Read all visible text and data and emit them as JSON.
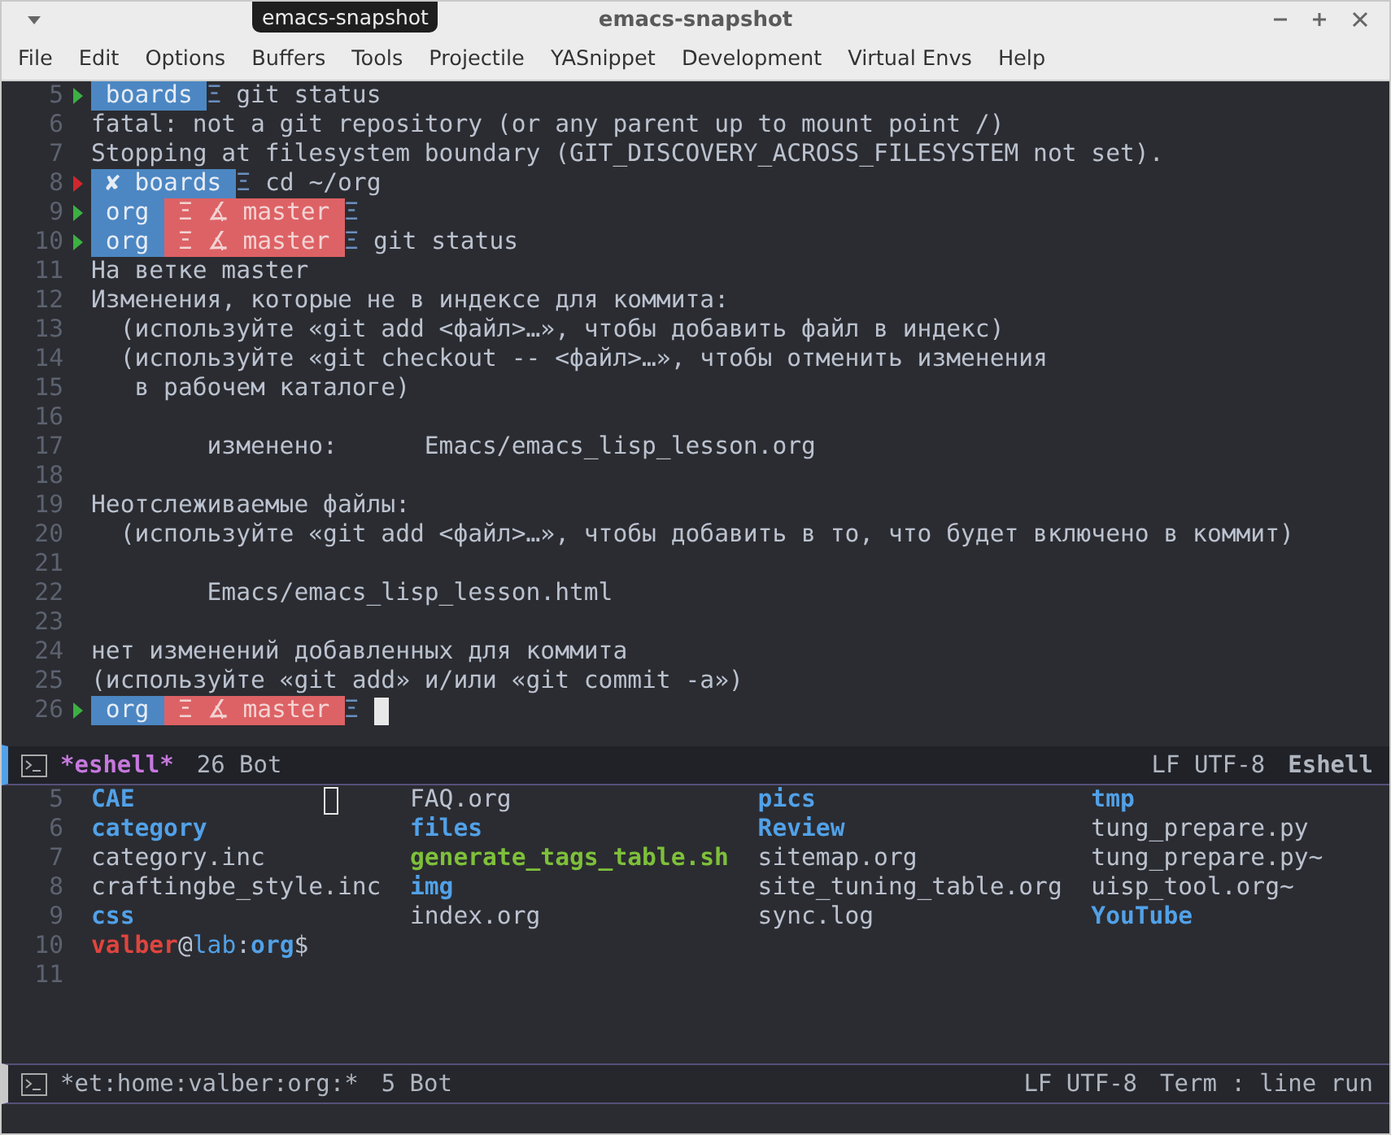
{
  "window": {
    "title": "emacs-snapshot",
    "tooltip": "emacs-snapshot"
  },
  "menu": [
    "File",
    "Edit",
    "Options",
    "Buffers",
    "Tools",
    "Projectile",
    "YASnippet",
    "Development",
    "Virtual Envs",
    "Help"
  ],
  "top_pane": {
    "lines": [
      {
        "number": "5",
        "kind": "prompt",
        "ok": true,
        "segments": [
          {
            "kind": "dir",
            "text": "boards"
          }
        ],
        "tail": "Ξ",
        "command": "git status",
        "cursor": false
      },
      {
        "number": "6",
        "kind": "text",
        "text": "fatal: not a git repository (or any parent up to mount point /)"
      },
      {
        "number": "7",
        "kind": "text",
        "text": "Stopping at filesystem boundary (GIT_DISCOVERY_ACROSS_FILESYSTEM not set)."
      },
      {
        "number": "8",
        "kind": "prompt",
        "ok": false,
        "segments": [
          {
            "kind": "dir",
            "text": "✘ boards"
          }
        ],
        "tail": "Ξ",
        "command": "cd ~/org",
        "cursor": false
      },
      {
        "number": "9",
        "kind": "prompt",
        "ok": true,
        "segments": [
          {
            "kind": "dir",
            "text": "org"
          },
          {
            "kind": "branch",
            "text": "Ξ ∡ master"
          }
        ],
        "tail": "Ξ",
        "cursor": false
      },
      {
        "number": "10",
        "kind": "prompt",
        "ok": true,
        "segments": [
          {
            "kind": "dir",
            "text": "org"
          },
          {
            "kind": "branch",
            "text": "Ξ ∡ master"
          }
        ],
        "tail": "Ξ",
        "command": "git status",
        "cursor": false
      },
      {
        "number": "11",
        "kind": "text",
        "text": "На ветке master"
      },
      {
        "number": "12",
        "kind": "text",
        "text": "Изменения, которые не в индексе для коммита:"
      },
      {
        "number": "13",
        "kind": "text",
        "text": "  (используйте «git add <файл>…», чтобы добавить файл в индекс)"
      },
      {
        "number": "14",
        "kind": "text",
        "text": "  (используйте «git checkout -- <файл>…», чтобы отменить изменения"
      },
      {
        "number": "15",
        "kind": "text",
        "text": "   в рабочем каталоге)"
      },
      {
        "number": "16",
        "kind": "blank"
      },
      {
        "number": "17",
        "kind": "text",
        "text": "        изменено:      Emacs/emacs_lisp_lesson.org"
      },
      {
        "number": "18",
        "kind": "blank"
      },
      {
        "number": "19",
        "kind": "text",
        "text": "Неотслеживаемые файлы:"
      },
      {
        "number": "20",
        "kind": "text",
        "text": "  (используйте «git add <файл>…», чтобы добавить в то, что будет включено в коммит)"
      },
      {
        "number": "21",
        "kind": "blank"
      },
      {
        "number": "22",
        "kind": "text",
        "text": "        Emacs/emacs_lisp_lesson.html"
      },
      {
        "number": "23",
        "kind": "blank"
      },
      {
        "number": "24",
        "kind": "text",
        "text": "нет изменений добавленных для коммита"
      },
      {
        "number": "25",
        "kind": "text",
        "text": "(используйте «git add» и/или «git commit -a»)"
      },
      {
        "number": "26",
        "kind": "prompt",
        "ok": true,
        "segments": [
          {
            "kind": "dir",
            "text": "org"
          },
          {
            "kind": "branch",
            "text": "Ξ ∡ master"
          }
        ],
        "tail": "Ξ",
        "cursor": true
      }
    ]
  },
  "top_modeline": {
    "active": true,
    "buffer": "*eshell*",
    "position": "26 Bot",
    "encoding": "LF UTF-8",
    "mode": "Eshell"
  },
  "bottom_pane": {
    "lines": [
      {
        "number": "5",
        "kind": "files",
        "cursor": true,
        "cells": [
          {
            "kind": "dir",
            "text": "CAE"
          },
          {
            "kind": "file",
            "text": "FAQ.org"
          },
          {
            "kind": "dir",
            "text": "pics"
          },
          {
            "kind": "dir",
            "text": "tmp"
          }
        ]
      },
      {
        "number": "6",
        "kind": "files",
        "cursor": false,
        "cells": [
          {
            "kind": "dir",
            "text": "category"
          },
          {
            "kind": "dir",
            "text": "files"
          },
          {
            "kind": "dir",
            "text": "Review"
          },
          {
            "kind": "file",
            "text": "tung_prepare.py"
          }
        ]
      },
      {
        "number": "7",
        "kind": "files",
        "cursor": false,
        "cells": [
          {
            "kind": "file",
            "text": "category.inc"
          },
          {
            "kind": "exec",
            "text": "generate_tags_table.sh"
          },
          {
            "kind": "file",
            "text": "sitemap.org"
          },
          {
            "kind": "file",
            "text": "tung_prepare.py~"
          }
        ]
      },
      {
        "number": "8",
        "kind": "files",
        "cursor": false,
        "cells": [
          {
            "kind": "file",
            "text": "craftingbe_style.inc"
          },
          {
            "kind": "dir",
            "text": "img"
          },
          {
            "kind": "file",
            "text": "site_tuning_table.org"
          },
          {
            "kind": "file",
            "text": "uisp_tool.org~"
          }
        ]
      },
      {
        "number": "9",
        "kind": "files",
        "cursor": false,
        "cells": [
          {
            "kind": "dir",
            "text": "css"
          },
          {
            "kind": "file",
            "text": "index.org"
          },
          {
            "kind": "file",
            "text": "sync.log"
          },
          {
            "kind": "dir",
            "text": "YouTube"
          }
        ]
      },
      {
        "number": "10",
        "kind": "shell_prompt",
        "parts": [
          {
            "kind": "user",
            "text": "valber"
          },
          {
            "kind": "plain",
            "text": "@"
          },
          {
            "kind": "host",
            "text": "lab"
          },
          {
            "kind": "plain",
            "text": ":"
          },
          {
            "kind": "dir",
            "text": "org"
          },
          {
            "kind": "plain",
            "text": "$"
          }
        ]
      },
      {
        "number": "11",
        "kind": "blank"
      }
    ]
  },
  "bottom_modeline": {
    "active": false,
    "buffer": "*et:home:valber:org:*",
    "position": "5 Bot",
    "encoding": "LF UTF-8",
    "mode": "Term : line run"
  }
}
